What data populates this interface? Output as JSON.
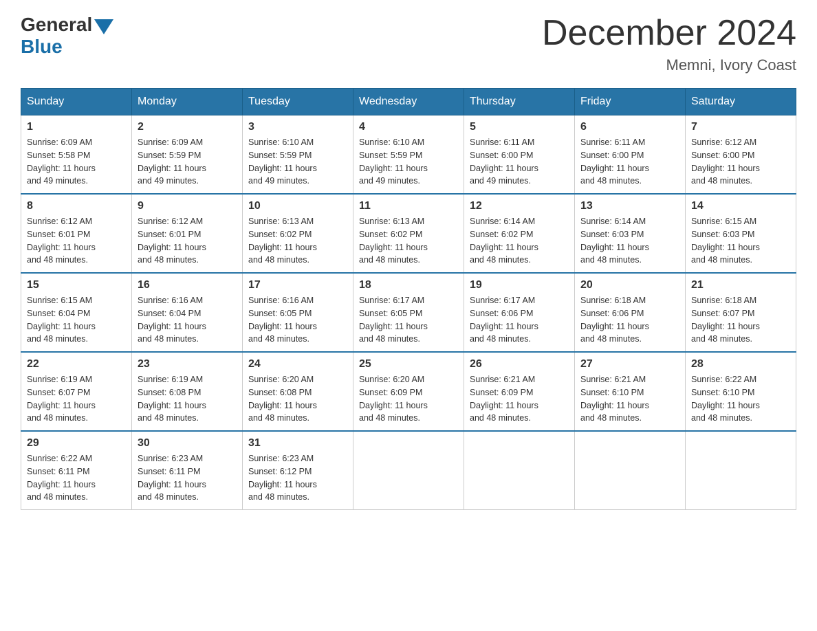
{
  "header": {
    "logo": {
      "general": "General",
      "blue": "Blue"
    },
    "title": "December 2024",
    "location": "Memni, Ivory Coast"
  },
  "weekdays": [
    "Sunday",
    "Monday",
    "Tuesday",
    "Wednesday",
    "Thursday",
    "Friday",
    "Saturday"
  ],
  "weeks": [
    [
      {
        "day": "1",
        "sunrise": "6:09 AM",
        "sunset": "5:58 PM",
        "daylight": "11 hours and 49 minutes."
      },
      {
        "day": "2",
        "sunrise": "6:09 AM",
        "sunset": "5:59 PM",
        "daylight": "11 hours and 49 minutes."
      },
      {
        "day": "3",
        "sunrise": "6:10 AM",
        "sunset": "5:59 PM",
        "daylight": "11 hours and 49 minutes."
      },
      {
        "day": "4",
        "sunrise": "6:10 AM",
        "sunset": "5:59 PM",
        "daylight": "11 hours and 49 minutes."
      },
      {
        "day": "5",
        "sunrise": "6:11 AM",
        "sunset": "6:00 PM",
        "daylight": "11 hours and 49 minutes."
      },
      {
        "day": "6",
        "sunrise": "6:11 AM",
        "sunset": "6:00 PM",
        "daylight": "11 hours and 48 minutes."
      },
      {
        "day": "7",
        "sunrise": "6:12 AM",
        "sunset": "6:00 PM",
        "daylight": "11 hours and 48 minutes."
      }
    ],
    [
      {
        "day": "8",
        "sunrise": "6:12 AM",
        "sunset": "6:01 PM",
        "daylight": "11 hours and 48 minutes."
      },
      {
        "day": "9",
        "sunrise": "6:12 AM",
        "sunset": "6:01 PM",
        "daylight": "11 hours and 48 minutes."
      },
      {
        "day": "10",
        "sunrise": "6:13 AM",
        "sunset": "6:02 PM",
        "daylight": "11 hours and 48 minutes."
      },
      {
        "day": "11",
        "sunrise": "6:13 AM",
        "sunset": "6:02 PM",
        "daylight": "11 hours and 48 minutes."
      },
      {
        "day": "12",
        "sunrise": "6:14 AM",
        "sunset": "6:02 PM",
        "daylight": "11 hours and 48 minutes."
      },
      {
        "day": "13",
        "sunrise": "6:14 AM",
        "sunset": "6:03 PM",
        "daylight": "11 hours and 48 minutes."
      },
      {
        "day": "14",
        "sunrise": "6:15 AM",
        "sunset": "6:03 PM",
        "daylight": "11 hours and 48 minutes."
      }
    ],
    [
      {
        "day": "15",
        "sunrise": "6:15 AM",
        "sunset": "6:04 PM",
        "daylight": "11 hours and 48 minutes."
      },
      {
        "day": "16",
        "sunrise": "6:16 AM",
        "sunset": "6:04 PM",
        "daylight": "11 hours and 48 minutes."
      },
      {
        "day": "17",
        "sunrise": "6:16 AM",
        "sunset": "6:05 PM",
        "daylight": "11 hours and 48 minutes."
      },
      {
        "day": "18",
        "sunrise": "6:17 AM",
        "sunset": "6:05 PM",
        "daylight": "11 hours and 48 minutes."
      },
      {
        "day": "19",
        "sunrise": "6:17 AM",
        "sunset": "6:06 PM",
        "daylight": "11 hours and 48 minutes."
      },
      {
        "day": "20",
        "sunrise": "6:18 AM",
        "sunset": "6:06 PM",
        "daylight": "11 hours and 48 minutes."
      },
      {
        "day": "21",
        "sunrise": "6:18 AM",
        "sunset": "6:07 PM",
        "daylight": "11 hours and 48 minutes."
      }
    ],
    [
      {
        "day": "22",
        "sunrise": "6:19 AM",
        "sunset": "6:07 PM",
        "daylight": "11 hours and 48 minutes."
      },
      {
        "day": "23",
        "sunrise": "6:19 AM",
        "sunset": "6:08 PM",
        "daylight": "11 hours and 48 minutes."
      },
      {
        "day": "24",
        "sunrise": "6:20 AM",
        "sunset": "6:08 PM",
        "daylight": "11 hours and 48 minutes."
      },
      {
        "day": "25",
        "sunrise": "6:20 AM",
        "sunset": "6:09 PM",
        "daylight": "11 hours and 48 minutes."
      },
      {
        "day": "26",
        "sunrise": "6:21 AM",
        "sunset": "6:09 PM",
        "daylight": "11 hours and 48 minutes."
      },
      {
        "day": "27",
        "sunrise": "6:21 AM",
        "sunset": "6:10 PM",
        "daylight": "11 hours and 48 minutes."
      },
      {
        "day": "28",
        "sunrise": "6:22 AM",
        "sunset": "6:10 PM",
        "daylight": "11 hours and 48 minutes."
      }
    ],
    [
      {
        "day": "29",
        "sunrise": "6:22 AM",
        "sunset": "6:11 PM",
        "daylight": "11 hours and 48 minutes."
      },
      {
        "day": "30",
        "sunrise": "6:23 AM",
        "sunset": "6:11 PM",
        "daylight": "11 hours and 48 minutes."
      },
      {
        "day": "31",
        "sunrise": "6:23 AM",
        "sunset": "6:12 PM",
        "daylight": "11 hours and 48 minutes."
      },
      null,
      null,
      null,
      null
    ]
  ],
  "labels": {
    "sunrise": "Sunrise:",
    "sunset": "Sunset:",
    "daylight": "Daylight:"
  },
  "colors": {
    "header_bg": "#2874a6",
    "header_text": "#ffffff",
    "border_accent": "#2874a6"
  }
}
